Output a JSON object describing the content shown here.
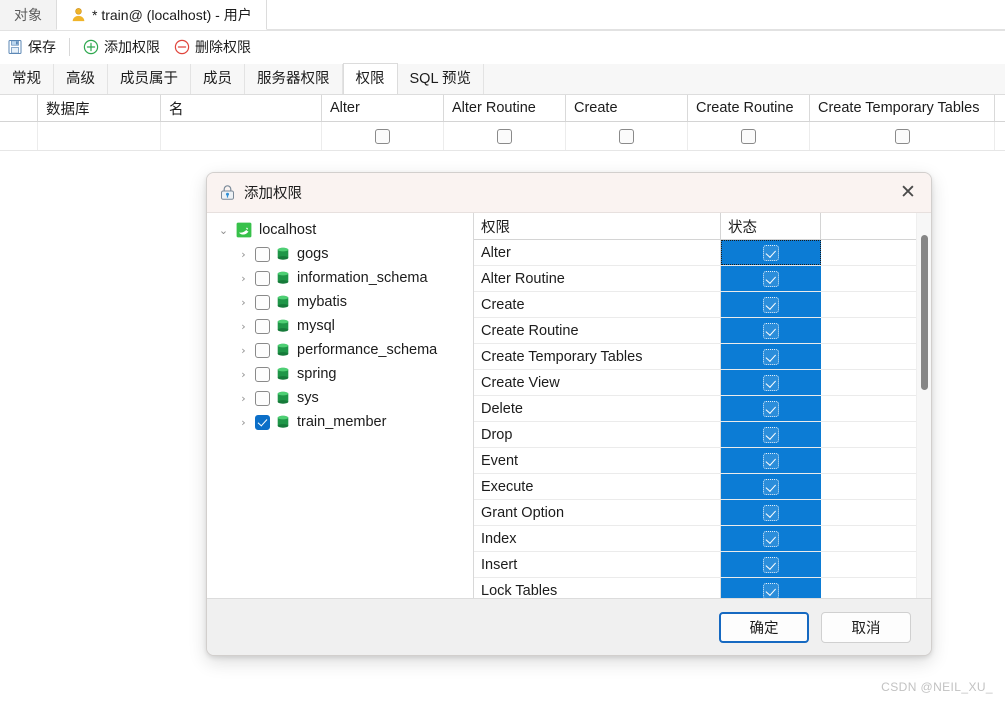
{
  "window": {
    "doc_tabs": [
      {
        "label": "对象",
        "active": false,
        "icon": null
      },
      {
        "label": "* train@ (localhost) - 用户",
        "active": true,
        "icon": "user-icon"
      }
    ]
  },
  "toolbar": {
    "save_label": "保存",
    "save_icon": "save-icon",
    "add_privilege_label": "添加权限",
    "add_privilege_icon": "plus-circle-icon",
    "add_privilege_color": "#2fa84f",
    "remove_privilege_label": "删除权限",
    "remove_privilege_icon": "minus-circle-icon",
    "remove_privilege_color": "#e0453c"
  },
  "subtabs": [
    {
      "label": "常规",
      "active": false
    },
    {
      "label": "高级",
      "active": false
    },
    {
      "label": "成员属于",
      "active": false
    },
    {
      "label": "成员",
      "active": false
    },
    {
      "label": "服务器权限",
      "active": false
    },
    {
      "label": "权限",
      "active": true
    },
    {
      "label": "SQL 预览",
      "active": false
    }
  ],
  "grid": {
    "columns": [
      "",
      "数据库",
      "名",
      "Alter",
      "Alter Routine",
      "Create",
      "Create Routine",
      "Create Temporary Tables"
    ],
    "rows": [
      {
        "gutter": "",
        "database": "",
        "name": "",
        "checks": [
          false,
          false,
          false,
          false,
          false
        ]
      }
    ]
  },
  "dialog": {
    "title": "添加权限",
    "title_icon": "lock-icon",
    "close_icon": "close-icon",
    "tree": {
      "root": {
        "label": "localhost",
        "icon": "mysql-dolphin-icon",
        "expanded": true,
        "expand_icon": "chevron-down-icon"
      },
      "children": [
        {
          "label": "gogs",
          "checked": false,
          "icon": "database-icon",
          "expand_icon": "chevron-right-icon"
        },
        {
          "label": "information_schema",
          "checked": false,
          "icon": "database-icon",
          "expand_icon": "chevron-right-icon"
        },
        {
          "label": "mybatis",
          "checked": false,
          "icon": "database-icon",
          "expand_icon": "chevron-right-icon"
        },
        {
          "label": "mysql",
          "checked": false,
          "icon": "database-icon",
          "expand_icon": "chevron-right-icon"
        },
        {
          "label": "performance_schema",
          "checked": false,
          "icon": "database-icon",
          "expand_icon": "chevron-right-icon"
        },
        {
          "label": "spring",
          "checked": false,
          "icon": "database-icon",
          "expand_icon": "chevron-right-icon"
        },
        {
          "label": "sys",
          "checked": false,
          "icon": "database-icon",
          "expand_icon": "chevron-right-icon"
        },
        {
          "label": "train_member",
          "checked": true,
          "icon": "database-icon",
          "expand_icon": "chevron-right-icon"
        }
      ]
    },
    "permission_table": {
      "headers": [
        "权限",
        "状态",
        ""
      ],
      "rows": [
        {
          "name": "Alter",
          "checked": true,
          "focused": true
        },
        {
          "name": "Alter Routine",
          "checked": true,
          "focused": false
        },
        {
          "name": "Create",
          "checked": true,
          "focused": false
        },
        {
          "name": "Create Routine",
          "checked": true,
          "focused": false
        },
        {
          "name": "Create Temporary Tables",
          "checked": true,
          "focused": false
        },
        {
          "name": "Create View",
          "checked": true,
          "focused": false
        },
        {
          "name": "Delete",
          "checked": true,
          "focused": false
        },
        {
          "name": "Drop",
          "checked": true,
          "focused": false
        },
        {
          "name": "Event",
          "checked": true,
          "focused": false
        },
        {
          "name": "Execute",
          "checked": true,
          "focused": false
        },
        {
          "name": "Grant Option",
          "checked": true,
          "focused": false
        },
        {
          "name": "Index",
          "checked": true,
          "focused": false
        },
        {
          "name": "Insert",
          "checked": true,
          "focused": false
        },
        {
          "name": "Lock Tables",
          "checked": true,
          "focused": false
        }
      ],
      "selection_color": "#0c7cd5"
    },
    "buttons": {
      "ok": "确定",
      "cancel": "取消"
    }
  },
  "watermark": "CSDN @NEIL_XU_"
}
